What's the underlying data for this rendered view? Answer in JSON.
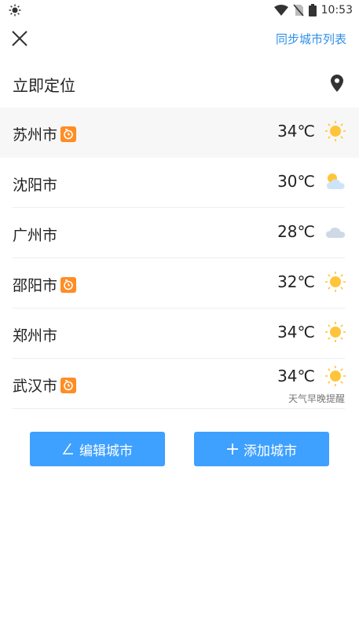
{
  "status_bar": {
    "time": "10:53",
    "icons": [
      "brightness-icon",
      "wifi-icon",
      "no-sim-icon",
      "battery-icon"
    ]
  },
  "header": {
    "close_icon": "close-icon",
    "sync_label": "同步城市列表"
  },
  "locate": {
    "label": "立即定位",
    "icon": "location-pin-icon"
  },
  "cities": [
    {
      "name": "苏州市",
      "badge": true,
      "temp": "34℃",
      "weather": "sunny",
      "active": true
    },
    {
      "name": "沈阳市",
      "badge": false,
      "temp": "30℃",
      "weather": "partly-cloudy"
    },
    {
      "name": "广州市",
      "badge": false,
      "temp": "28℃",
      "weather": "cloudy"
    },
    {
      "name": "邵阳市",
      "badge": true,
      "temp": "32℃",
      "weather": "sunny"
    },
    {
      "name": "郑州市",
      "badge": false,
      "temp": "34℃",
      "weather": "sunny"
    },
    {
      "name": "武汉市",
      "badge": true,
      "temp": "34℃",
      "weather": "sunny",
      "note": "天气早晚提醒"
    }
  ],
  "buttons": {
    "edit_label": "编辑城市",
    "add_label": "添加城市"
  },
  "colors": {
    "accent": "#3ea0ff",
    "link": "#2f8fe8",
    "badge": "#ff8d24",
    "sun": "#ffc53a"
  }
}
